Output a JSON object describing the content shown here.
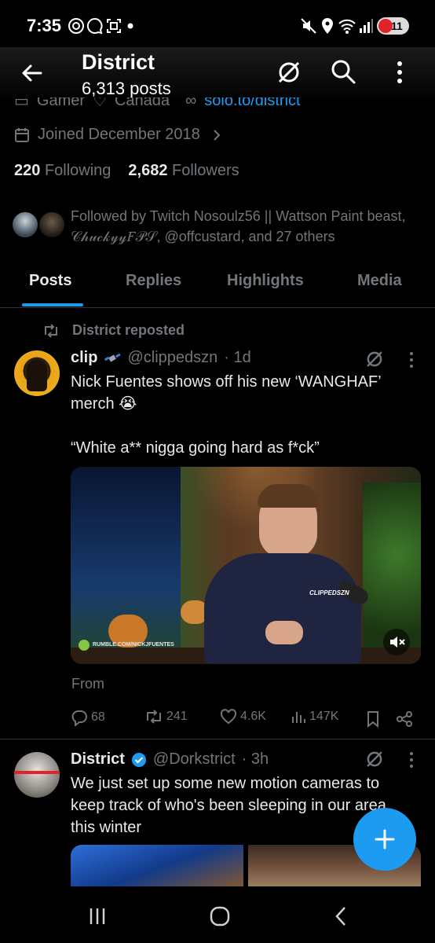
{
  "status_bar": {
    "time": "7:35",
    "battery": "11"
  },
  "header": {
    "title": "District",
    "posts_count": "6,313 posts"
  },
  "profile": {
    "partial_row": {
      "category": "Gamer",
      "location": "Canada",
      "link": "solo.to/district"
    },
    "joined": "Joined December 2018",
    "following_count": "220",
    "following_label": "Following",
    "followers_count": "2,682",
    "followers_label": "Followers",
    "followed_by": "Followed by Twitch Nosoulz56 || Wattson Paint beast, 𝒞𝒽𝓊𝒸𝓀𝓎𝓎𝐹𝒫𝒮, @offcustard, and 27 others"
  },
  "tabs": [
    {
      "label": "Posts"
    },
    {
      "label": "Replies"
    },
    {
      "label": "Highlights"
    },
    {
      "label": "Media"
    }
  ],
  "tweets": [
    {
      "repost_label": "District reposted",
      "name": "clip",
      "handle": "@clippedszn",
      "time": "· 1d",
      "text_line1": "Nick Fuentes shows off his new ‘WANGHAF’",
      "text_line2": "merch 😭",
      "quote": "“White a** nigga going hard as f*ck”",
      "media_watermark": "CLIPPEDSZN",
      "media_caption": "RUMBLE.COM/NICKJFUENTES",
      "from_label": "From",
      "replies": "68",
      "reposts": "241",
      "likes": "4.6K",
      "views": "147K"
    },
    {
      "name": "District",
      "handle": "@Dorkstrict",
      "time": "· 3h",
      "text_line1": "We just set up some new motion cameras to",
      "text_line2": "keep track of who's been sleeping in our area",
      "text_line3": "this winter"
    }
  ],
  "colors": {
    "accent": "#1d9bf0",
    "background": "#000000",
    "muted": "#71767b"
  }
}
